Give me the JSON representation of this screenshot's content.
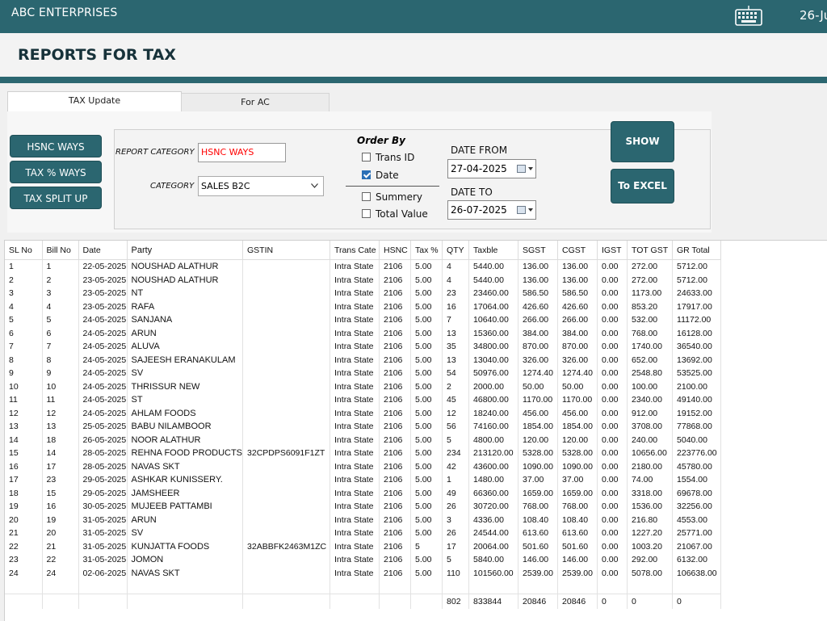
{
  "app": {
    "title": "ABC ENTERPRISES",
    "date_fragment": "26-Ju"
  },
  "page": {
    "title": "REPORTS FOR TAX"
  },
  "tabs": [
    {
      "label": "TAX Update"
    },
    {
      "label": "For AC"
    }
  ],
  "side_buttons": {
    "hsnc": "HSNC WAYS",
    "tax_percent": "TAX % WAYS",
    "tax_split": "TAX SPLIT UP"
  },
  "filters": {
    "report_category_label": "REPORT CATEGORY",
    "report_category_value": "HSNC WAYS",
    "report_category_color": "#ff0000",
    "category_label": "CATEGORY",
    "category_value": "SALES B2C",
    "order_by_label": "Order By",
    "order_options": [
      {
        "label": "Trans ID",
        "checked": false
      },
      {
        "label": "Date",
        "checked": true
      },
      {
        "label": "Summery",
        "checked": false
      },
      {
        "label": "Total Value",
        "checked": false
      }
    ],
    "date_from_label": "DATE FROM",
    "date_from": "27-04-2025",
    "date_to_label": "DATE TO",
    "date_to": "26-07-2025"
  },
  "actions": {
    "show": "SHOW",
    "excel": "To EXCEL"
  },
  "table": {
    "columns": [
      "SL No",
      "Bill No",
      "Date",
      "Party",
      "GSTIN",
      "Trans Cate",
      "HSNC",
      "Tax %",
      "QTY",
      "Taxble",
      "SGST",
      "CGST",
      "IGST",
      "TOT GST",
      "GR Total"
    ],
    "rows": [
      [
        "1",
        "1",
        "22-05-2025",
        "NOUSHAD ALATHUR",
        "",
        "Intra State",
        "2106",
        "5.00",
        "4",
        "5440.00",
        "136.00",
        "136.00",
        "0.00",
        "272.00",
        "5712.00"
      ],
      [
        "2",
        "2",
        "23-05-2025",
        "NOUSHAD ALATHUR",
        "",
        "Intra State",
        "2106",
        "5.00",
        "4",
        "5440.00",
        "136.00",
        "136.00",
        "0.00",
        "272.00",
        "5712.00"
      ],
      [
        "3",
        "3",
        "23-05-2025",
        "NT",
        "",
        "Intra State",
        "2106",
        "5.00",
        "23",
        "23460.00",
        "586.50",
        "586.50",
        "0.00",
        "1173.00",
        "24633.00"
      ],
      [
        "4",
        "4",
        "23-05-2025",
        "RAFA",
        "",
        "Intra State",
        "2106",
        "5.00",
        "16",
        "17064.00",
        "426.60",
        "426.60",
        "0.00",
        "853.20",
        "17917.00"
      ],
      [
        "5",
        "5",
        "24-05-2025",
        "SANJANA",
        "",
        "Intra State",
        "2106",
        "5.00",
        "7",
        "10640.00",
        "266.00",
        "266.00",
        "0.00",
        "532.00",
        "11172.00"
      ],
      [
        "6",
        "6",
        "24-05-2025",
        "ARUN",
        "",
        "Intra State",
        "2106",
        "5.00",
        "13",
        "15360.00",
        "384.00",
        "384.00",
        "0.00",
        "768.00",
        "16128.00"
      ],
      [
        "7",
        "7",
        "24-05-2025",
        "ALUVA",
        "",
        "Intra State",
        "2106",
        "5.00",
        "35",
        "34800.00",
        "870.00",
        "870.00",
        "0.00",
        "1740.00",
        "36540.00"
      ],
      [
        "8",
        "8",
        "24-05-2025",
        "SAJEESH ERANAKULAM",
        "",
        "Intra State",
        "2106",
        "5.00",
        "13",
        "13040.00",
        "326.00",
        "326.00",
        "0.00",
        "652.00",
        "13692.00"
      ],
      [
        "9",
        "9",
        "24-05-2025",
        "SV",
        "",
        "Intra State",
        "2106",
        "5.00",
        "54",
        "50976.00",
        "1274.40",
        "1274.40",
        "0.00",
        "2548.80",
        "53525.00"
      ],
      [
        "10",
        "10",
        "24-05-2025",
        "THRISSUR NEW",
        "",
        "Intra State",
        "2106",
        "5.00",
        "2",
        "2000.00",
        "50.00",
        "50.00",
        "0.00",
        "100.00",
        "2100.00"
      ],
      [
        "11",
        "11",
        "24-05-2025",
        "ST",
        "",
        "Intra State",
        "2106",
        "5.00",
        "45",
        "46800.00",
        "1170.00",
        "1170.00",
        "0.00",
        "2340.00",
        "49140.00"
      ],
      [
        "12",
        "12",
        "24-05-2025",
        "AHLAM FOODS",
        "",
        "Intra State",
        "2106",
        "5.00",
        "12",
        "18240.00",
        "456.00",
        "456.00",
        "0.00",
        "912.00",
        "19152.00"
      ],
      [
        "13",
        "13",
        "25-05-2025",
        "BABU NILAMBOOR",
        "",
        "Intra State",
        "2106",
        "5.00",
        "56",
        "74160.00",
        "1854.00",
        "1854.00",
        "0.00",
        "3708.00",
        "77868.00"
      ],
      [
        "14",
        "18",
        "26-05-2025",
        "NOOR ALATHUR",
        "",
        "Intra State",
        "2106",
        "5.00",
        "5",
        "4800.00",
        "120.00",
        "120.00",
        "0.00",
        "240.00",
        "5040.00"
      ],
      [
        "15",
        "14",
        "28-05-2025",
        "REHNA FOOD PRODUCTS",
        "32CPDPS6091F1ZT",
        "Intra State",
        "2106",
        "5.00",
        "234",
        "213120.00",
        "5328.00",
        "5328.00",
        "0.00",
        "10656.00",
        "223776.00"
      ],
      [
        "16",
        "17",
        "28-05-2025",
        "NAVAS SKT",
        "",
        "Intra State",
        "2106",
        "5.00",
        "42",
        "43600.00",
        "1090.00",
        "1090.00",
        "0.00",
        "2180.00",
        "45780.00"
      ],
      [
        "17",
        "23",
        "29-05-2025",
        "ASHKAR KUNISSERY.",
        "",
        "Intra State",
        "2106",
        "5.00",
        "1",
        "1480.00",
        "37.00",
        "37.00",
        "0.00",
        "74.00",
        "1554.00"
      ],
      [
        "18",
        "15",
        "29-05-2025",
        "JAMSHEER",
        "",
        "Intra State",
        "2106",
        "5.00",
        "49",
        "66360.00",
        "1659.00",
        "1659.00",
        "0.00",
        "3318.00",
        "69678.00"
      ],
      [
        "19",
        "16",
        "30-05-2025",
        "MUJEEB PATTAMBI",
        "",
        "Intra State",
        "2106",
        "5.00",
        "26",
        "30720.00",
        "768.00",
        "768.00",
        "0.00",
        "1536.00",
        "32256.00"
      ],
      [
        "20",
        "19",
        "31-05-2025",
        "ARUN",
        "",
        "Intra State",
        "2106",
        "5.00",
        "3",
        "4336.00",
        "108.40",
        "108.40",
        "0.00",
        "216.80",
        "4553.00"
      ],
      [
        "21",
        "20",
        "31-05-2025",
        "SV",
        "",
        "Intra State",
        "2106",
        "5.00",
        "26",
        "24544.00",
        "613.60",
        "613.60",
        "0.00",
        "1227.20",
        "25771.00"
      ],
      [
        "22",
        "21",
        "31-05-2025",
        "KUNJATTA FOODS",
        "32ABBFK2463M1ZC",
        "Intra State",
        "2106",
        "5",
        "17",
        "20064.00",
        "501.60",
        "501.60",
        "0.00",
        "1003.20",
        "21067.00"
      ],
      [
        "23",
        "22",
        "31-05-2025",
        "JOMON",
        "",
        "Intra State",
        "2106",
        "5.00",
        "5",
        "5840.00",
        "146.00",
        "146.00",
        "0.00",
        "292.00",
        "6132.00"
      ],
      [
        "24",
        "24",
        "02-06-2025",
        "NAVAS SKT",
        "",
        "Intra State",
        "2106",
        "5.00",
        "110",
        "101560.00",
        "2539.00",
        "2539.00",
        "0.00",
        "5078.00",
        "106638.00"
      ]
    ],
    "totals": [
      "",
      "",
      "",
      "",
      "",
      "",
      "",
      "",
      "802",
      "833844",
      "20846",
      "20846",
      "0",
      "0",
      "0"
    ]
  }
}
